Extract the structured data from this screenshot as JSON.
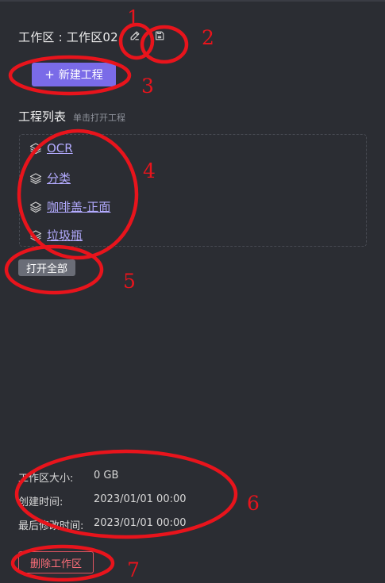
{
  "workspace": {
    "title": "工作区 : 工作区02",
    "edit_icon": "pencil-icon",
    "save_icon": "save-icon"
  },
  "actions": {
    "new_project_plus": "+",
    "new_project_label": "新建工程",
    "open_all_label": "打开全部",
    "delete_label": "删除工作区"
  },
  "project_section": {
    "title": "工程列表",
    "hint": "单击打开工程",
    "item_icon": "layers-icon",
    "items": [
      {
        "label": "OCR"
      },
      {
        "label": "分类"
      },
      {
        "label": "咖啡盖-正面"
      },
      {
        "label": "垃圾瓶"
      }
    ]
  },
  "info": {
    "size_label": "工作区大小:",
    "size_value": "0 GB",
    "created_label": "创建时间:",
    "created_value": "2023/01/01 00:00",
    "modified_label": "最后修改时间:",
    "modified_value": "2023/01/01 00:00"
  },
  "annotations": {
    "labels": [
      "1",
      "2",
      "3",
      "4",
      "5",
      "6",
      "7"
    ],
    "color": "#e8141c"
  },
  "colors": {
    "background": "#2b2d33",
    "accent": "#7a6be8",
    "link": "#b3abff",
    "danger": "#ff6f7a"
  }
}
